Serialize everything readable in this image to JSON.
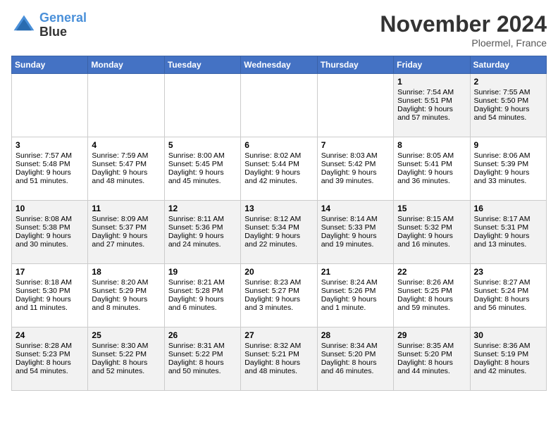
{
  "header": {
    "logo_line1": "General",
    "logo_line2": "Blue",
    "month": "November 2024",
    "location": "Ploermel, France"
  },
  "days_of_week": [
    "Sunday",
    "Monday",
    "Tuesday",
    "Wednesday",
    "Thursday",
    "Friday",
    "Saturday"
  ],
  "weeks": [
    [
      {
        "day": "",
        "content": ""
      },
      {
        "day": "",
        "content": ""
      },
      {
        "day": "",
        "content": ""
      },
      {
        "day": "",
        "content": ""
      },
      {
        "day": "",
        "content": ""
      },
      {
        "day": "1",
        "content": "Sunrise: 7:54 AM\nSunset: 5:51 PM\nDaylight: 9 hours and 57 minutes."
      },
      {
        "day": "2",
        "content": "Sunrise: 7:55 AM\nSunset: 5:50 PM\nDaylight: 9 hours and 54 minutes."
      }
    ],
    [
      {
        "day": "3",
        "content": "Sunrise: 7:57 AM\nSunset: 5:48 PM\nDaylight: 9 hours and 51 minutes."
      },
      {
        "day": "4",
        "content": "Sunrise: 7:59 AM\nSunset: 5:47 PM\nDaylight: 9 hours and 48 minutes."
      },
      {
        "day": "5",
        "content": "Sunrise: 8:00 AM\nSunset: 5:45 PM\nDaylight: 9 hours and 45 minutes."
      },
      {
        "day": "6",
        "content": "Sunrise: 8:02 AM\nSunset: 5:44 PM\nDaylight: 9 hours and 42 minutes."
      },
      {
        "day": "7",
        "content": "Sunrise: 8:03 AM\nSunset: 5:42 PM\nDaylight: 9 hours and 39 minutes."
      },
      {
        "day": "8",
        "content": "Sunrise: 8:05 AM\nSunset: 5:41 PM\nDaylight: 9 hours and 36 minutes."
      },
      {
        "day": "9",
        "content": "Sunrise: 8:06 AM\nSunset: 5:39 PM\nDaylight: 9 hours and 33 minutes."
      }
    ],
    [
      {
        "day": "10",
        "content": "Sunrise: 8:08 AM\nSunset: 5:38 PM\nDaylight: 9 hours and 30 minutes."
      },
      {
        "day": "11",
        "content": "Sunrise: 8:09 AM\nSunset: 5:37 PM\nDaylight: 9 hours and 27 minutes."
      },
      {
        "day": "12",
        "content": "Sunrise: 8:11 AM\nSunset: 5:36 PM\nDaylight: 9 hours and 24 minutes."
      },
      {
        "day": "13",
        "content": "Sunrise: 8:12 AM\nSunset: 5:34 PM\nDaylight: 9 hours and 22 minutes."
      },
      {
        "day": "14",
        "content": "Sunrise: 8:14 AM\nSunset: 5:33 PM\nDaylight: 9 hours and 19 minutes."
      },
      {
        "day": "15",
        "content": "Sunrise: 8:15 AM\nSunset: 5:32 PM\nDaylight: 9 hours and 16 minutes."
      },
      {
        "day": "16",
        "content": "Sunrise: 8:17 AM\nSunset: 5:31 PM\nDaylight: 9 hours and 13 minutes."
      }
    ],
    [
      {
        "day": "17",
        "content": "Sunrise: 8:18 AM\nSunset: 5:30 PM\nDaylight: 9 hours and 11 minutes."
      },
      {
        "day": "18",
        "content": "Sunrise: 8:20 AM\nSunset: 5:29 PM\nDaylight: 9 hours and 8 minutes."
      },
      {
        "day": "19",
        "content": "Sunrise: 8:21 AM\nSunset: 5:28 PM\nDaylight: 9 hours and 6 minutes."
      },
      {
        "day": "20",
        "content": "Sunrise: 8:23 AM\nSunset: 5:27 PM\nDaylight: 9 hours and 3 minutes."
      },
      {
        "day": "21",
        "content": "Sunrise: 8:24 AM\nSunset: 5:26 PM\nDaylight: 9 hours and 1 minute."
      },
      {
        "day": "22",
        "content": "Sunrise: 8:26 AM\nSunset: 5:25 PM\nDaylight: 8 hours and 59 minutes."
      },
      {
        "day": "23",
        "content": "Sunrise: 8:27 AM\nSunset: 5:24 PM\nDaylight: 8 hours and 56 minutes."
      }
    ],
    [
      {
        "day": "24",
        "content": "Sunrise: 8:28 AM\nSunset: 5:23 PM\nDaylight: 8 hours and 54 minutes."
      },
      {
        "day": "25",
        "content": "Sunrise: 8:30 AM\nSunset: 5:22 PM\nDaylight: 8 hours and 52 minutes."
      },
      {
        "day": "26",
        "content": "Sunrise: 8:31 AM\nSunset: 5:22 PM\nDaylight: 8 hours and 50 minutes."
      },
      {
        "day": "27",
        "content": "Sunrise: 8:32 AM\nSunset: 5:21 PM\nDaylight: 8 hours and 48 minutes."
      },
      {
        "day": "28",
        "content": "Sunrise: 8:34 AM\nSunset: 5:20 PM\nDaylight: 8 hours and 46 minutes."
      },
      {
        "day": "29",
        "content": "Sunrise: 8:35 AM\nSunset: 5:20 PM\nDaylight: 8 hours and 44 minutes."
      },
      {
        "day": "30",
        "content": "Sunrise: 8:36 AM\nSunset: 5:19 PM\nDaylight: 8 hours and 42 minutes."
      }
    ]
  ]
}
